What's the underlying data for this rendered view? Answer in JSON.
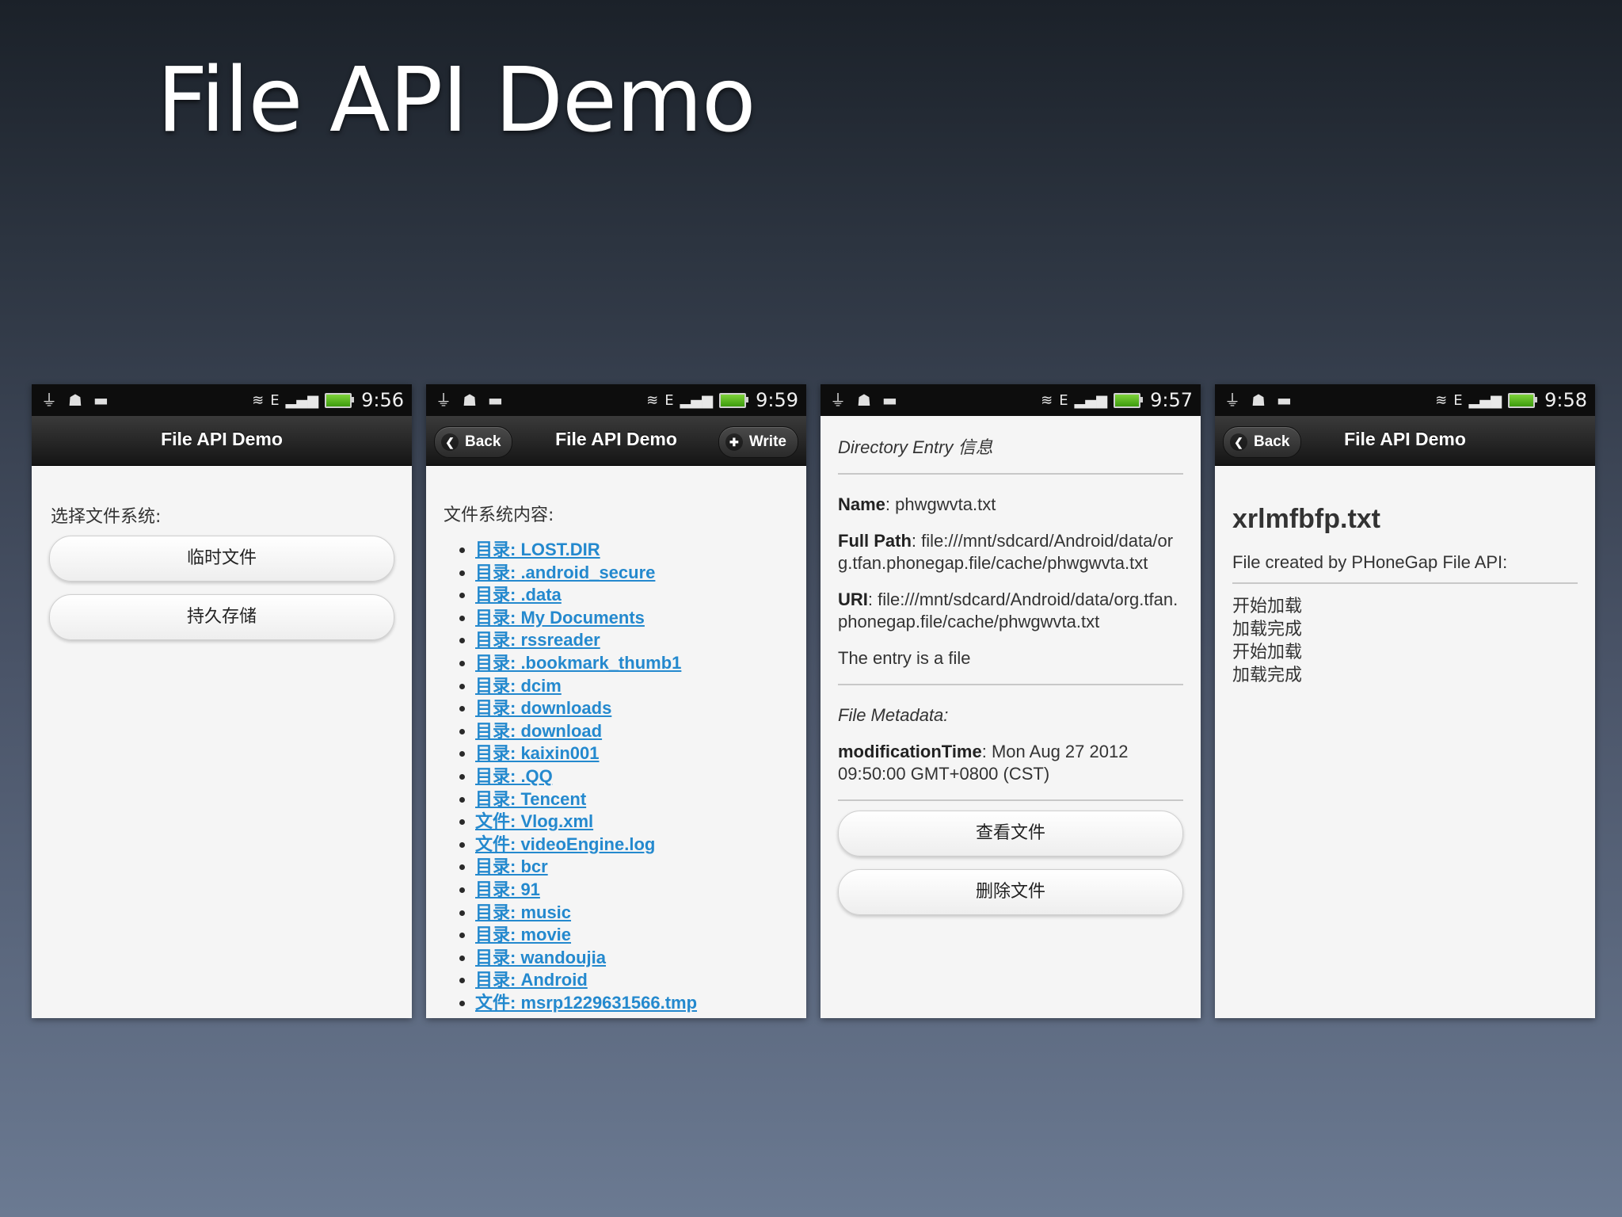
{
  "slide": {
    "title": "File API Demo"
  },
  "status_bars": [
    {
      "time": "9:56"
    },
    {
      "time": "9:59"
    },
    {
      "time": "9:57"
    },
    {
      "time": "9:58"
    }
  ],
  "status_icons": {
    "network": "E"
  },
  "phone1": {
    "header_title": "File API Demo",
    "prompt": "选择文件系统:",
    "buttons": [
      "临时文件",
      "持久存储"
    ]
  },
  "phone2": {
    "back_label": "Back",
    "header_title": "File API Demo",
    "write_label": "Write",
    "heading": "文件系统内容:",
    "items": [
      "目录: LOST.DIR",
      "目录: .android_secure",
      "目录: .data",
      "目录: My Documents",
      "目录: rssreader",
      "目录: .bookmark_thumb1",
      "目录: dcim",
      "目录: downloads",
      "目录: download",
      "目录: kaixin001",
      "目录: .QQ",
      "目录: Tencent",
      "文件: Vlog.xml",
      "文件: videoEngine.log",
      "目录: bcr",
      "目录: 91",
      "目录: music",
      "目录: movie",
      "目录: wandoujia",
      "目录: Android",
      "文件: msrp1229631566.tmp"
    ]
  },
  "phone3": {
    "section_title": "Directory Entry 信息",
    "name_label": "Name",
    "name_value": ": phwgwvta.txt",
    "fullpath_label": "Full Path",
    "fullpath_value": ": file:///mnt/sdcard/Android/data/org.tfan.phonegap.file/cache/phwgwvta.txt",
    "uri_label": "URI",
    "uri_value": ": file:///mnt/sdcard/Android/data/org.tfan.phonegap.file/cache/phwgwvta.txt",
    "entry_type": "The entry is a file",
    "metadata_title": "File Metadata:",
    "modtime_label": "modificationTime",
    "modtime_value": ": Mon Aug 27 2012 09:50:00 GMT+0800 (CST)",
    "view_button": "查看文件",
    "delete_button": "删除文件"
  },
  "phone4": {
    "back_label": "Back",
    "header_title": "File API Demo",
    "file_name": "xrlmfbfp.txt",
    "file_desc": "File created by PHoneGap File API:",
    "log": [
      "开始加载",
      "加载完成",
      "开始加载",
      "加载完成"
    ]
  }
}
